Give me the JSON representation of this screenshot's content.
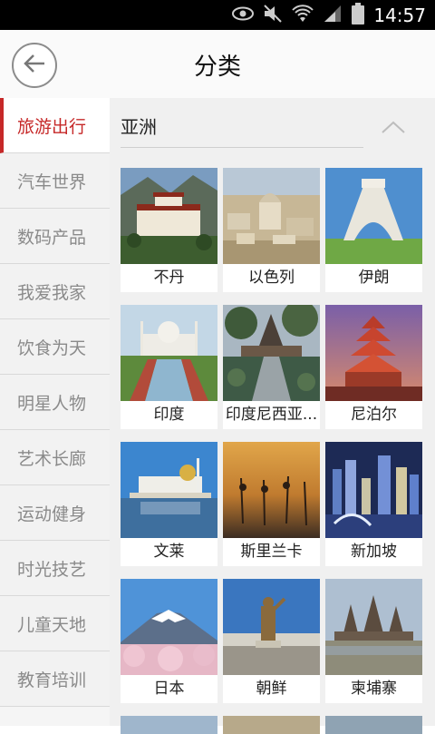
{
  "status_bar": {
    "time": "14:57"
  },
  "header": {
    "title": "分类"
  },
  "sidebar": {
    "items": [
      {
        "label": "旅游出行",
        "active": true
      },
      {
        "label": "汽车世界",
        "active": false
      },
      {
        "label": "数码产品",
        "active": false
      },
      {
        "label": "我爱我家",
        "active": false
      },
      {
        "label": "饮食为天",
        "active": false
      },
      {
        "label": "明星人物",
        "active": false
      },
      {
        "label": "艺术长廊",
        "active": false
      },
      {
        "label": "运动健身",
        "active": false
      },
      {
        "label": "时光技艺",
        "active": false
      },
      {
        "label": "儿童天地",
        "active": false
      },
      {
        "label": "教育培训",
        "active": false
      }
    ]
  },
  "main": {
    "region": "亚洲",
    "places": [
      {
        "name": "不丹"
      },
      {
        "name": "以色列"
      },
      {
        "name": "伊朗"
      },
      {
        "name": "印度"
      },
      {
        "name": "印度尼西亚..."
      },
      {
        "name": "尼泊尔"
      },
      {
        "name": "文莱"
      },
      {
        "name": "斯里兰卡"
      },
      {
        "name": "新加坡"
      },
      {
        "name": "日本"
      },
      {
        "name": "朝鲜"
      },
      {
        "name": "柬埔寨"
      }
    ]
  },
  "colors": {
    "accent": "#c62828",
    "status_bar": "#000000",
    "header_bg": "#fafafa"
  }
}
